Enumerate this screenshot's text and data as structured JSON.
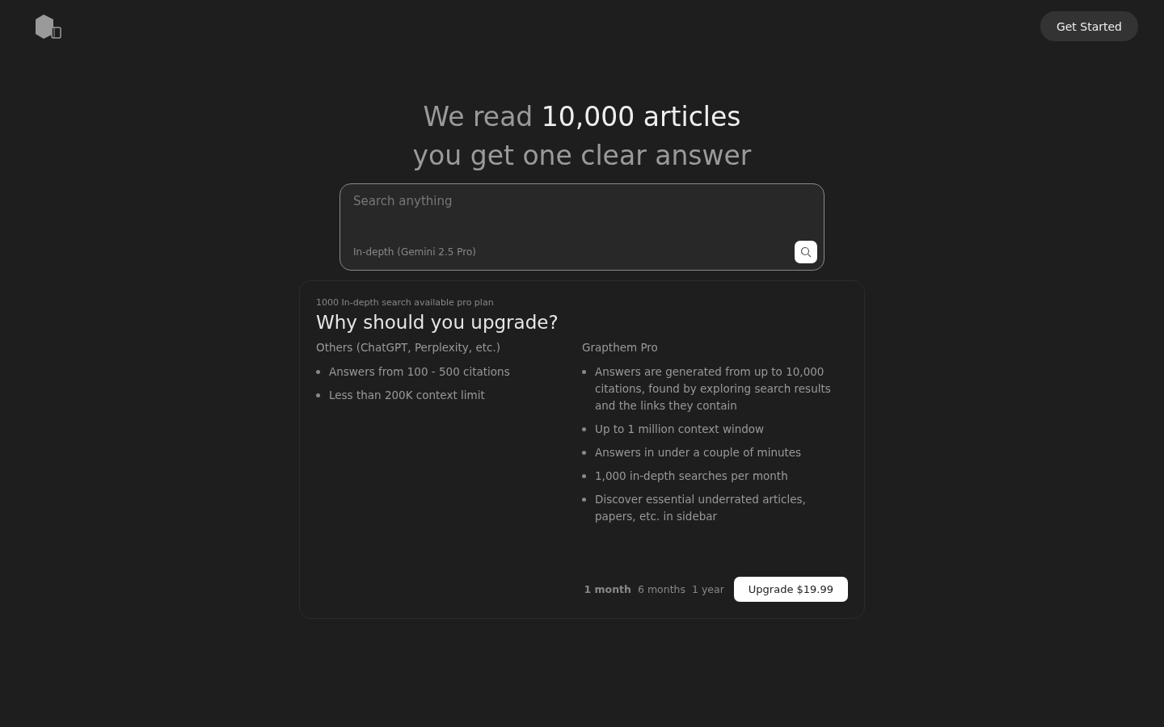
{
  "header": {
    "button": "Get Started"
  },
  "headline": {
    "lead": "We read ",
    "highlight": "10,000 articles",
    "line2": "you get one clear answer"
  },
  "search": {
    "placeholder": "Search anything",
    "mode": "In-depth (Gemini 2.5 Pro)"
  },
  "upgrade": {
    "note": "1000 In-depth search available pro plan",
    "title": "Why should you upgrade?",
    "columns": [
      {
        "heading": "Others (ChatGPT, Perplexity, etc.)",
        "items": [
          "Answers from 100 - 500 citations",
          "Less than 200K context limit"
        ]
      },
      {
        "heading": "Grapthem Pro",
        "items": [
          "Answers are generated from up to 10,000 citations, found by exploring search results and the links they contain",
          "Up to 1 million context window",
          "Answers in under a couple of minutes",
          "1,000 in-depth searches per month",
          "Discover essential underrated articles, papers, etc. in sidebar"
        ]
      }
    ],
    "periods": [
      {
        "label": "1 month",
        "selected": true
      },
      {
        "label": "6 months",
        "selected": false
      },
      {
        "label": "1 year",
        "selected": false
      }
    ],
    "button": "Upgrade $19.99"
  }
}
